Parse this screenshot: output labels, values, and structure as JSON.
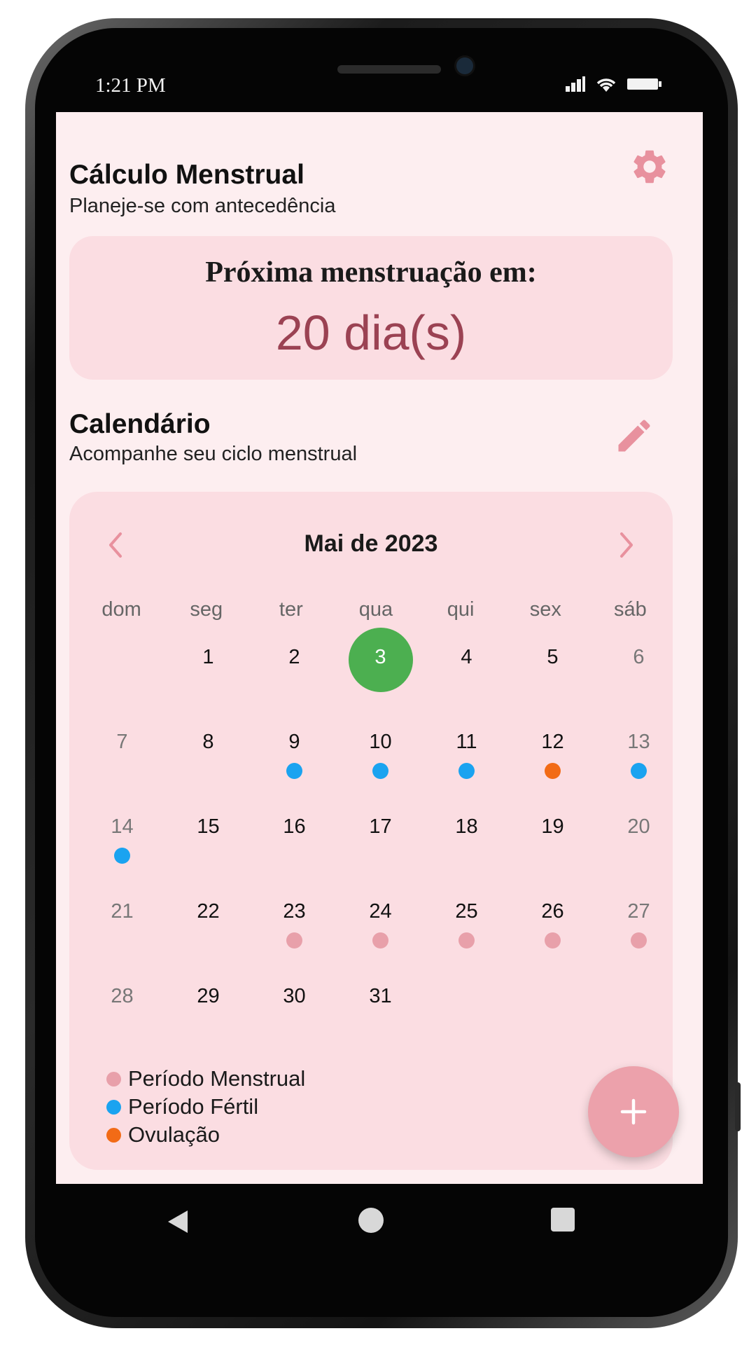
{
  "status_bar": {
    "time": "1:21 PM"
  },
  "header": {
    "title": "Cálculo Menstrual",
    "subtitle": "Planeje-se com antecedência"
  },
  "next_period": {
    "label": "Próxima menstruação em:",
    "value": "20 dia(s)"
  },
  "calendar_section": {
    "title": "Calendário",
    "subtitle": "Acompanhe seu ciclo menstrual"
  },
  "calendar": {
    "month_label": "Mai de 2023",
    "weekdays": [
      "dom",
      "seg",
      "ter",
      "qua",
      "qui",
      "sex",
      "sáb"
    ],
    "weeks": [
      [
        {
          "day": "",
          "marker": null
        },
        {
          "day": "1",
          "marker": null
        },
        {
          "day": "2",
          "marker": null
        },
        {
          "day": "3",
          "marker": "today"
        },
        {
          "day": "4",
          "marker": null
        },
        {
          "day": "5",
          "marker": null
        },
        {
          "day": "6",
          "marker": null
        }
      ],
      [
        {
          "day": "7",
          "marker": null
        },
        {
          "day": "8",
          "marker": null
        },
        {
          "day": "9",
          "marker": "fertile"
        },
        {
          "day": "10",
          "marker": "fertile"
        },
        {
          "day": "11",
          "marker": "fertile"
        },
        {
          "day": "12",
          "marker": "ovulation"
        },
        {
          "day": "13",
          "marker": "fertile"
        }
      ],
      [
        {
          "day": "14",
          "marker": "fertile"
        },
        {
          "day": "15",
          "marker": null
        },
        {
          "day": "16",
          "marker": null
        },
        {
          "day": "17",
          "marker": null
        },
        {
          "day": "18",
          "marker": null
        },
        {
          "day": "19",
          "marker": null
        },
        {
          "day": "20",
          "marker": null
        }
      ],
      [
        {
          "day": "21",
          "marker": null
        },
        {
          "day": "22",
          "marker": null
        },
        {
          "day": "23",
          "marker": "menstrual"
        },
        {
          "day": "24",
          "marker": "menstrual"
        },
        {
          "day": "25",
          "marker": "menstrual"
        },
        {
          "day": "26",
          "marker": "menstrual"
        },
        {
          "day": "27",
          "marker": "menstrual"
        }
      ],
      [
        {
          "day": "28",
          "marker": null
        },
        {
          "day": "29",
          "marker": null
        },
        {
          "day": "30",
          "marker": null
        },
        {
          "day": "31",
          "marker": null
        },
        {
          "day": "",
          "marker": null
        },
        {
          "day": "",
          "marker": null
        },
        {
          "day": "",
          "marker": null
        }
      ]
    ]
  },
  "legend": [
    {
      "label": "Período Menstrual",
      "color": "#e8a0aa"
    },
    {
      "label": "Período Fértil",
      "color": "#1aa3f0"
    },
    {
      "label": "Ovulação",
      "color": "#f26b16"
    }
  ],
  "colors": {
    "today": "#4caf50",
    "menstrual": "#e8a0aa",
    "fertile": "#1aa3f0",
    "ovulation": "#f26b16",
    "accent": "#eca1ab",
    "next_value": "#9b4253"
  },
  "icons": {
    "settings": "gear-icon",
    "edit": "pencil-icon",
    "prev_month": "chevron-left-icon",
    "next_month": "chevron-right-icon",
    "fab": "plus-icon",
    "nav_back": "triangle-back-icon",
    "nav_home": "circle-home-icon",
    "nav_recent": "square-recent-icon"
  }
}
